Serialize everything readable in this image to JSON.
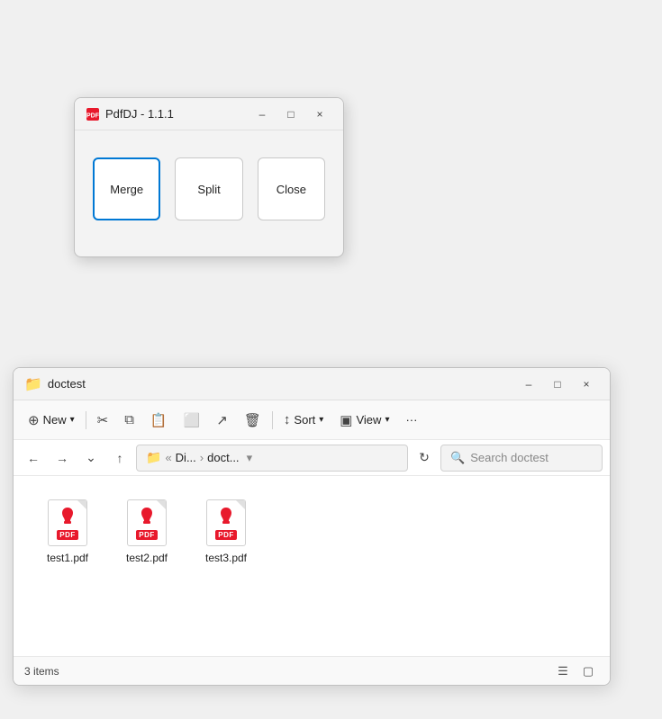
{
  "pdfdj": {
    "title": "PdfDJ - 1.1.1",
    "buttons": {
      "merge": "Merge",
      "split": "Split",
      "close": "Close"
    },
    "window_controls": {
      "minimize": "–",
      "maximize": "□",
      "close": "×"
    }
  },
  "explorer": {
    "title": "doctest",
    "window_controls": {
      "minimize": "–",
      "maximize": "□",
      "close": "×"
    },
    "toolbar": {
      "new_label": "New",
      "sort_label": "Sort",
      "view_label": "View",
      "more_icon": "···"
    },
    "addressbar": {
      "path_parts": [
        "Di...",
        "doct..."
      ],
      "search_placeholder": "Search doctest"
    },
    "files": [
      {
        "name": "test1.pdf",
        "type": "pdf"
      },
      {
        "name": "test2.pdf",
        "type": "pdf"
      },
      {
        "name": "test3.pdf",
        "type": "pdf"
      }
    ],
    "statusbar": {
      "items_count": "3 items",
      "items_label": "items"
    }
  }
}
